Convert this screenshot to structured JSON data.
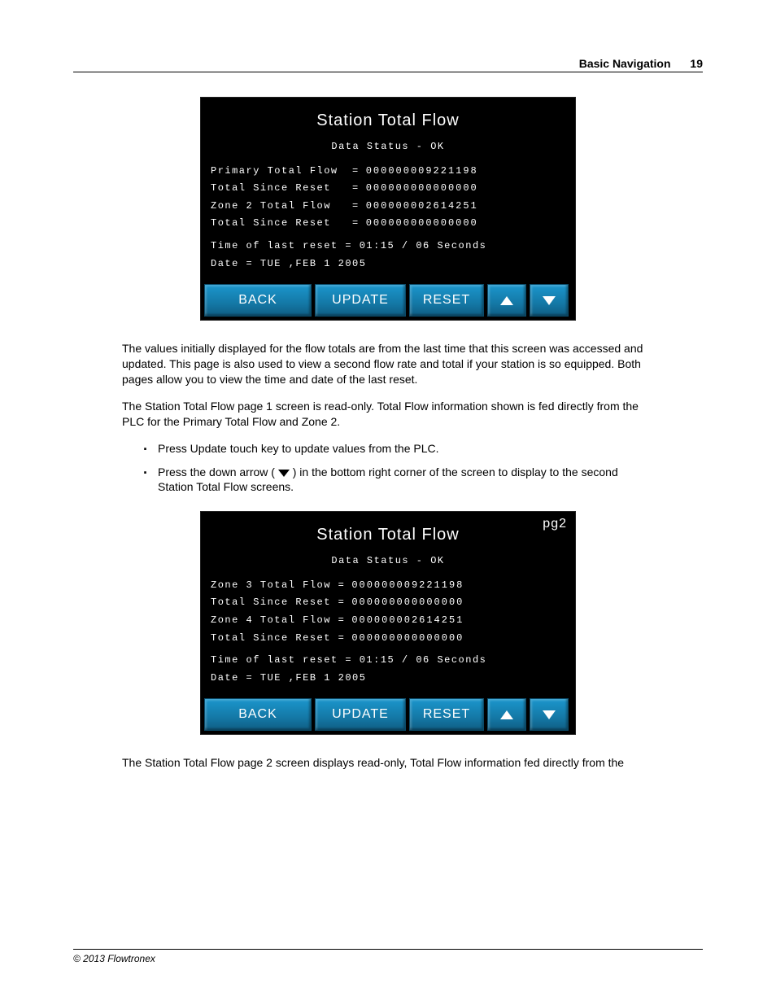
{
  "header": {
    "title": "Basic Navigation",
    "page_number": "19"
  },
  "footer": {
    "copyright": "© 2013 Flowtronex"
  },
  "screen1": {
    "title": "Station Total Flow",
    "status": "Data Status - OK",
    "rows": [
      {
        "label": "Primary Total Flow  =",
        "value": "000000009221198"
      },
      {
        "label": "Total Since Reset   =",
        "value": "000000000000000"
      },
      {
        "label": "Zone 2 Total Flow   =",
        "value": "000000002614251"
      },
      {
        "label": "Total Since Reset   =",
        "value": "000000000000000"
      }
    ],
    "reset_time": "Time of last reset = 01:15 / 06 Seconds",
    "reset_date": "Date = TUE ,FEB  1  2005",
    "buttons": {
      "back": "BACK",
      "update": "UPDATE",
      "reset": "RESET"
    }
  },
  "screen2": {
    "title": "Station Total Flow",
    "page_tag": "pg2",
    "status": "Data Status - OK",
    "rows": [
      {
        "label": "Zone 3 Total Flow =",
        "value": "000000009221198"
      },
      {
        "label": "Total Since Reset =",
        "value": "000000000000000"
      },
      {
        "label": "Zone 4 Total Flow =",
        "value": "000000002614251"
      },
      {
        "label": "Total Since Reset =",
        "value": "000000000000000"
      }
    ],
    "reset_time": "Time of last reset = 01:15 / 06 Seconds",
    "reset_date": "Date = TUE ,FEB  1  2005",
    "buttons": {
      "back": "BACK",
      "update": "UPDATE",
      "reset": "RESET"
    }
  },
  "body": {
    "p1": "The values initially displayed for the flow totals are from the last time that this screen was accessed and updated. This page is also used to view a second flow rate and total if your station is so equipped. Both pages allow you to view the time and date of the last reset.",
    "p2": "The Station Total Flow page 1 screen is read-only. Total Flow information shown is fed directly from the PLC for the Primary Total Flow and Zone 2.",
    "b1": "Press Update touch key to update values from the PLC.",
    "b2a": "Press the down arrow ( ",
    "b2b": " ) in the bottom right corner of the screen to display to the second Station Total Flow screens.",
    "p3": "The Station Total Flow page 2 screen displays read-only, Total Flow information fed directly from the"
  }
}
